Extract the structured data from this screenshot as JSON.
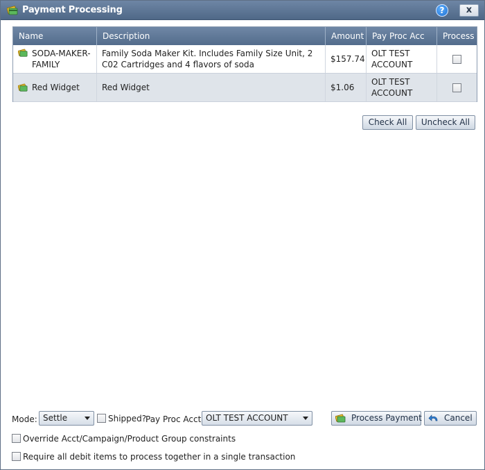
{
  "window": {
    "title": "Payment Processing",
    "help_label": "?",
    "close_label": "x"
  },
  "grid": {
    "columns": [
      "Name",
      "Description",
      "Amount",
      "Pay Proc Acc",
      "Process"
    ],
    "rows": [
      {
        "name": "SODA-MAKER-FAMILY",
        "description": "Family Soda Maker Kit. Includes Family Size Unit, 2 C02 Cartridges and 4 flavors of soda",
        "amount": "$157.74",
        "pay_proc_acc": "OLT TEST ACCOUNT",
        "process_checked": false
      },
      {
        "name": "Red Widget",
        "description": "Red Widget",
        "amount": "$1.06",
        "pay_proc_acc": "OLT TEST ACCOUNT",
        "process_checked": false
      }
    ]
  },
  "actions": {
    "check_all": "Check All",
    "uncheck_all": "Uncheck All"
  },
  "footer": {
    "mode_label": "Mode:",
    "mode_value": "Settle",
    "shipped_label": "Shipped?",
    "shipped_checked": false,
    "pay_proc_acct_label": "Pay Proc Acct:",
    "pay_proc_acct_value": "OLT TEST ACCOUNT",
    "process_payment": "Process Payment",
    "cancel": "Cancel",
    "override_label": "Override Acct/Campaign/Product Group constraints",
    "override_checked": false,
    "require_label": "Require all debit items to process together in a single transaction",
    "require_checked": false
  },
  "colors": {
    "titlebar": "#5a7394",
    "header": "#607a9a",
    "alt_row": "#dfe4ea"
  }
}
